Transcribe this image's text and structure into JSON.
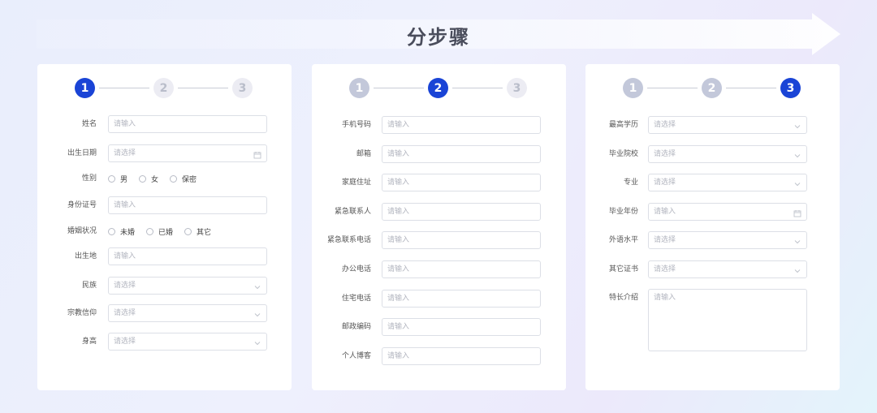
{
  "banner": {
    "title": "分步骤"
  },
  "colors": {
    "active": "#1a44d6",
    "done": "#c3c8da",
    "todo": "#ececf3"
  },
  "cards": [
    {
      "steps": [
        {
          "num": "1",
          "state": "active"
        },
        {
          "num": "2",
          "state": "todo"
        },
        {
          "num": "3",
          "state": "todo"
        }
      ],
      "fields": [
        {
          "label": "姓名",
          "type": "input",
          "placeholder": "请输入"
        },
        {
          "label": "出生日期",
          "type": "date",
          "placeholder": "请选择",
          "icon": "calendar-icon"
        },
        {
          "label": "性别",
          "type": "radio",
          "options": [
            "男",
            "女",
            "保密"
          ]
        },
        {
          "label": "身份证号",
          "type": "input",
          "placeholder": "请输入"
        },
        {
          "label": "婚姻状况",
          "type": "radio",
          "options": [
            "未婚",
            "已婚",
            "其它"
          ]
        },
        {
          "label": "出生地",
          "type": "input",
          "placeholder": "请输入"
        },
        {
          "label": "民族",
          "type": "select",
          "placeholder": "请选择",
          "icon": "chevron-down-icon"
        },
        {
          "label": "宗教信仰",
          "type": "select",
          "placeholder": "请选择",
          "icon": "chevron-down-icon"
        },
        {
          "label": "身高",
          "type": "select",
          "placeholder": "请选择",
          "icon": "chevron-down-icon"
        }
      ]
    },
    {
      "steps": [
        {
          "num": "1",
          "state": "done"
        },
        {
          "num": "2",
          "state": "active"
        },
        {
          "num": "3",
          "state": "todo"
        }
      ],
      "fields": [
        {
          "label": "手机号码",
          "type": "input",
          "placeholder": "请输入"
        },
        {
          "label": "邮箱",
          "type": "input",
          "placeholder": "请输入"
        },
        {
          "label": "家庭住址",
          "type": "input",
          "placeholder": "请输入"
        },
        {
          "label": "紧急联系人",
          "type": "input",
          "placeholder": "请输入"
        },
        {
          "label": "紧急联系电话",
          "type": "input",
          "placeholder": "请输入"
        },
        {
          "label": "办公电话",
          "type": "input",
          "placeholder": "请输入"
        },
        {
          "label": "住宅电话",
          "type": "input",
          "placeholder": "请输入"
        },
        {
          "label": "邮政编码",
          "type": "input",
          "placeholder": "请输入"
        },
        {
          "label": "个人博客",
          "type": "input",
          "placeholder": "请输入"
        }
      ]
    },
    {
      "steps": [
        {
          "num": "1",
          "state": "done"
        },
        {
          "num": "2",
          "state": "done"
        },
        {
          "num": "3",
          "state": "active"
        }
      ],
      "fields": [
        {
          "label": "最高学历",
          "type": "select",
          "placeholder": "请选择",
          "icon": "chevron-down-icon"
        },
        {
          "label": "毕业院校",
          "type": "select",
          "placeholder": "请选择",
          "icon": "chevron-down-icon"
        },
        {
          "label": "专业",
          "type": "select",
          "placeholder": "请选择",
          "icon": "chevron-down-icon"
        },
        {
          "label": "毕业年份",
          "type": "date",
          "placeholder": "请输入",
          "icon": "calendar-icon"
        },
        {
          "label": "外语水平",
          "type": "select",
          "placeholder": "请选择",
          "icon": "chevron-down-icon"
        },
        {
          "label": "其它证书",
          "type": "select",
          "placeholder": "请选择",
          "icon": "chevron-down-icon"
        },
        {
          "label": "特长介绍",
          "type": "textarea",
          "placeholder": "请输入"
        }
      ]
    }
  ]
}
